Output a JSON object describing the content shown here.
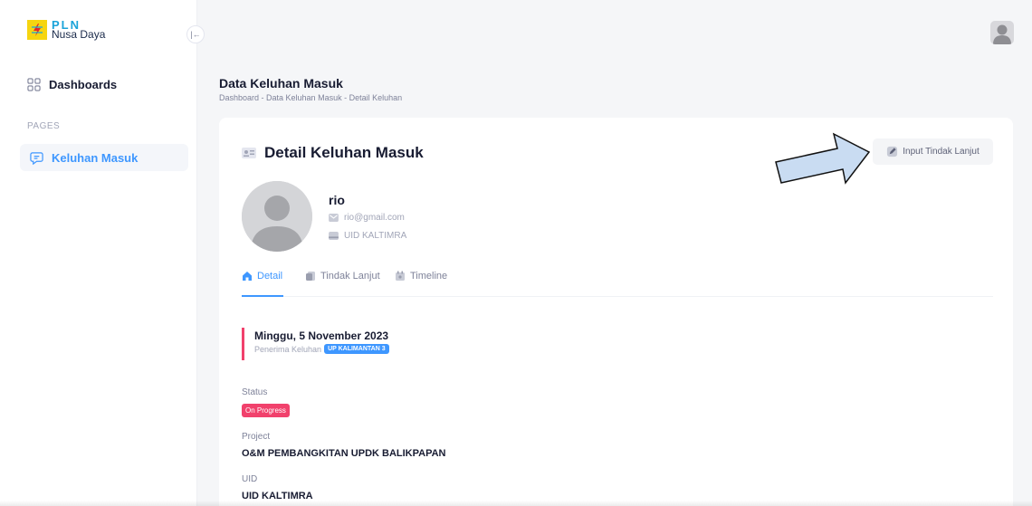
{
  "brand": {
    "name_top": "PLN",
    "name_bottom": "Nusa Daya"
  },
  "sidebar": {
    "dashboards_label": "Dashboards",
    "section_label": "PAGES",
    "keluhan_label": "Keluhan Masuk"
  },
  "header": {
    "title": "Data Keluhan Masuk",
    "breadcrumb": "Dashboard - Data Keluhan Masuk - Detail Keluhan"
  },
  "card": {
    "title": "Detail Keluhan Masuk",
    "action_label": "Input Tindak Lanjut"
  },
  "user": {
    "name": "rio",
    "email": "rio@gmail.com",
    "uid": "UID KALTIMRA"
  },
  "tabs": [
    {
      "label": "Detail",
      "active": true
    },
    {
      "label": "Tindak Lanjut",
      "active": false
    },
    {
      "label": "Timeline",
      "active": false
    }
  ],
  "detail": {
    "date": "Minggu, 5 November 2023",
    "penerima_label": "Penerima Keluhan",
    "penerima_value": "UP KALIMANTAN 3",
    "status_label": "Status",
    "status_value": "On Progress",
    "project_label": "Project",
    "project_value": "O&M PEMBANGKITAN UPDK BALIKPAPAN",
    "uid_label": "UID",
    "uid_value": "UID KALTIMRA"
  },
  "colors": {
    "primary": "#3e97ff",
    "danger": "#f1416c",
    "brand_yellow": "#f6d510",
    "brand_blue": "#1aa3d9",
    "annotation_arrow": "#c9dcf2"
  }
}
